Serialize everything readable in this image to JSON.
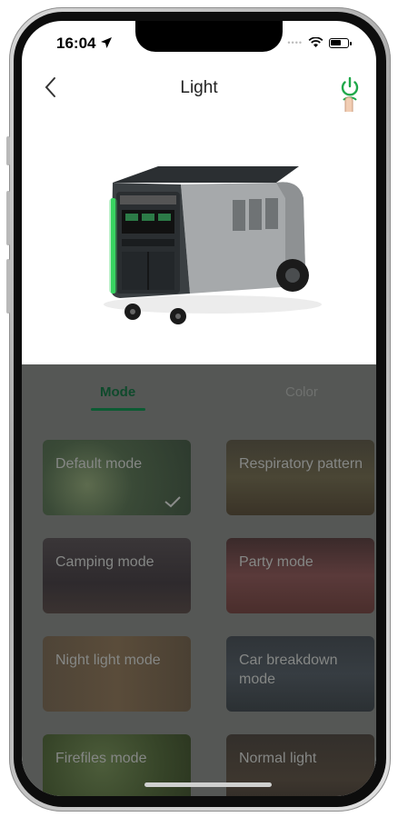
{
  "status_bar": {
    "time": "16:04"
  },
  "nav": {
    "title": "Light"
  },
  "tabs": [
    {
      "label": "Mode",
      "active": true
    },
    {
      "label": "Color",
      "active": false
    }
  ],
  "modes": [
    {
      "label": "Default mode",
      "selected": true
    },
    {
      "label": "Respiratory pattern",
      "selected": false
    },
    {
      "label": "Camping mode",
      "selected": false
    },
    {
      "label": "Party mode",
      "selected": false
    },
    {
      "label": "Night light mode",
      "selected": false
    },
    {
      "label": "Car breakdown mode",
      "selected": false
    },
    {
      "label": "Firefiles mode",
      "selected": false
    },
    {
      "label": "Normal light",
      "selected": false
    }
  ],
  "colors": {
    "accent": "#0d5b33",
    "power_icon": "#1fa84a",
    "overlay": "#555755"
  }
}
